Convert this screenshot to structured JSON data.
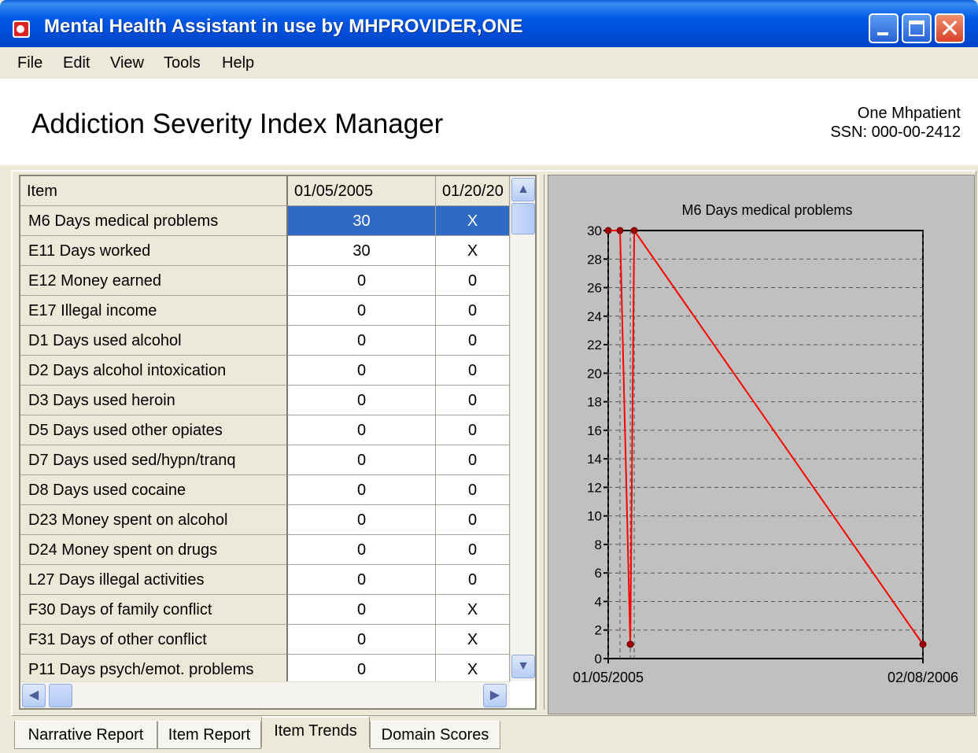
{
  "window": {
    "title": "Mental Health Assistant in use by MHPROVIDER,ONE",
    "icon": "mha-app-icon",
    "controls": {
      "minimize": "minimize-icon",
      "maximize": "maximize-icon",
      "close": "close-icon"
    }
  },
  "menu": {
    "items": [
      {
        "label": "File"
      },
      {
        "label": "Edit"
      },
      {
        "label": "View"
      },
      {
        "label": "Tools"
      },
      {
        "label": "Help"
      }
    ]
  },
  "header": {
    "title": "Addiction Severity Index Manager",
    "patient_name": "One Mhpatient",
    "patient_ssn": "SSN: 000-00-2412"
  },
  "grid": {
    "columns": [
      "Item",
      "01/05/2005",
      "01/20/20"
    ],
    "selected_row": 0,
    "rows": [
      {
        "item": "M6 Days medical problems",
        "v1": "30",
        "v2": "X"
      },
      {
        "item": "E11 Days worked",
        "v1": "30",
        "v2": "X"
      },
      {
        "item": "E12 Money earned",
        "v1": "0",
        "v2": "0"
      },
      {
        "item": "E17 Illegal income",
        "v1": "0",
        "v2": "0"
      },
      {
        "item": "D1 Days used alcohol",
        "v1": "0",
        "v2": "0"
      },
      {
        "item": "D2 Days alcohol intoxication",
        "v1": "0",
        "v2": "0"
      },
      {
        "item": "D3 Days used heroin",
        "v1": "0",
        "v2": "0"
      },
      {
        "item": "D5 Days used other opiates",
        "v1": "0",
        "v2": "0"
      },
      {
        "item": "D7 Days used sed/hypn/tranq",
        "v1": "0",
        "v2": "0"
      },
      {
        "item": "D8 Days used cocaine",
        "v1": "0",
        "v2": "0"
      },
      {
        "item": "D23 Money spent on alcohol",
        "v1": "0",
        "v2": "0"
      },
      {
        "item": "D24 Money spent on drugs",
        "v1": "0",
        "v2": "0"
      },
      {
        "item": "L27 Days illegal activities",
        "v1": "0",
        "v2": "0"
      },
      {
        "item": "F30 Days of family conflict",
        "v1": "0",
        "v2": "X"
      },
      {
        "item": "F31 Days of other conflict",
        "v1": "0",
        "v2": "X"
      },
      {
        "item": "P11 Days psych/emot. problems",
        "v1": "0",
        "v2": "X"
      }
    ]
  },
  "chart_data": {
    "type": "line",
    "title": "M6 Days medical problems",
    "xlabel": "",
    "ylabel": "",
    "x_start": "01/05/2005",
    "x_end": "02/08/2006",
    "x_tick_labels": [
      "01/05/2005",
      "02/08/2006"
    ],
    "x": [
      "01/05/2005",
      "01/20/2005",
      "02/02/2005",
      "02/07/2005",
      "02/08/2006"
    ],
    "y": [
      30,
      30,
      1,
      30,
      1
    ],
    "ylim": [
      0,
      30
    ],
    "y_ticks": [
      0,
      2,
      4,
      6,
      8,
      10,
      12,
      14,
      16,
      18,
      20,
      22,
      24,
      26,
      28,
      30
    ],
    "grid": true,
    "line_color": "#ff0000",
    "marker_color": "#a00000",
    "background": "#c0c0c0"
  },
  "tabs": {
    "items": [
      {
        "label": "Narrative Report"
      },
      {
        "label": "Item Report"
      },
      {
        "label": "Item Trends"
      },
      {
        "label": "Domain Scores"
      }
    ],
    "active": 2
  }
}
